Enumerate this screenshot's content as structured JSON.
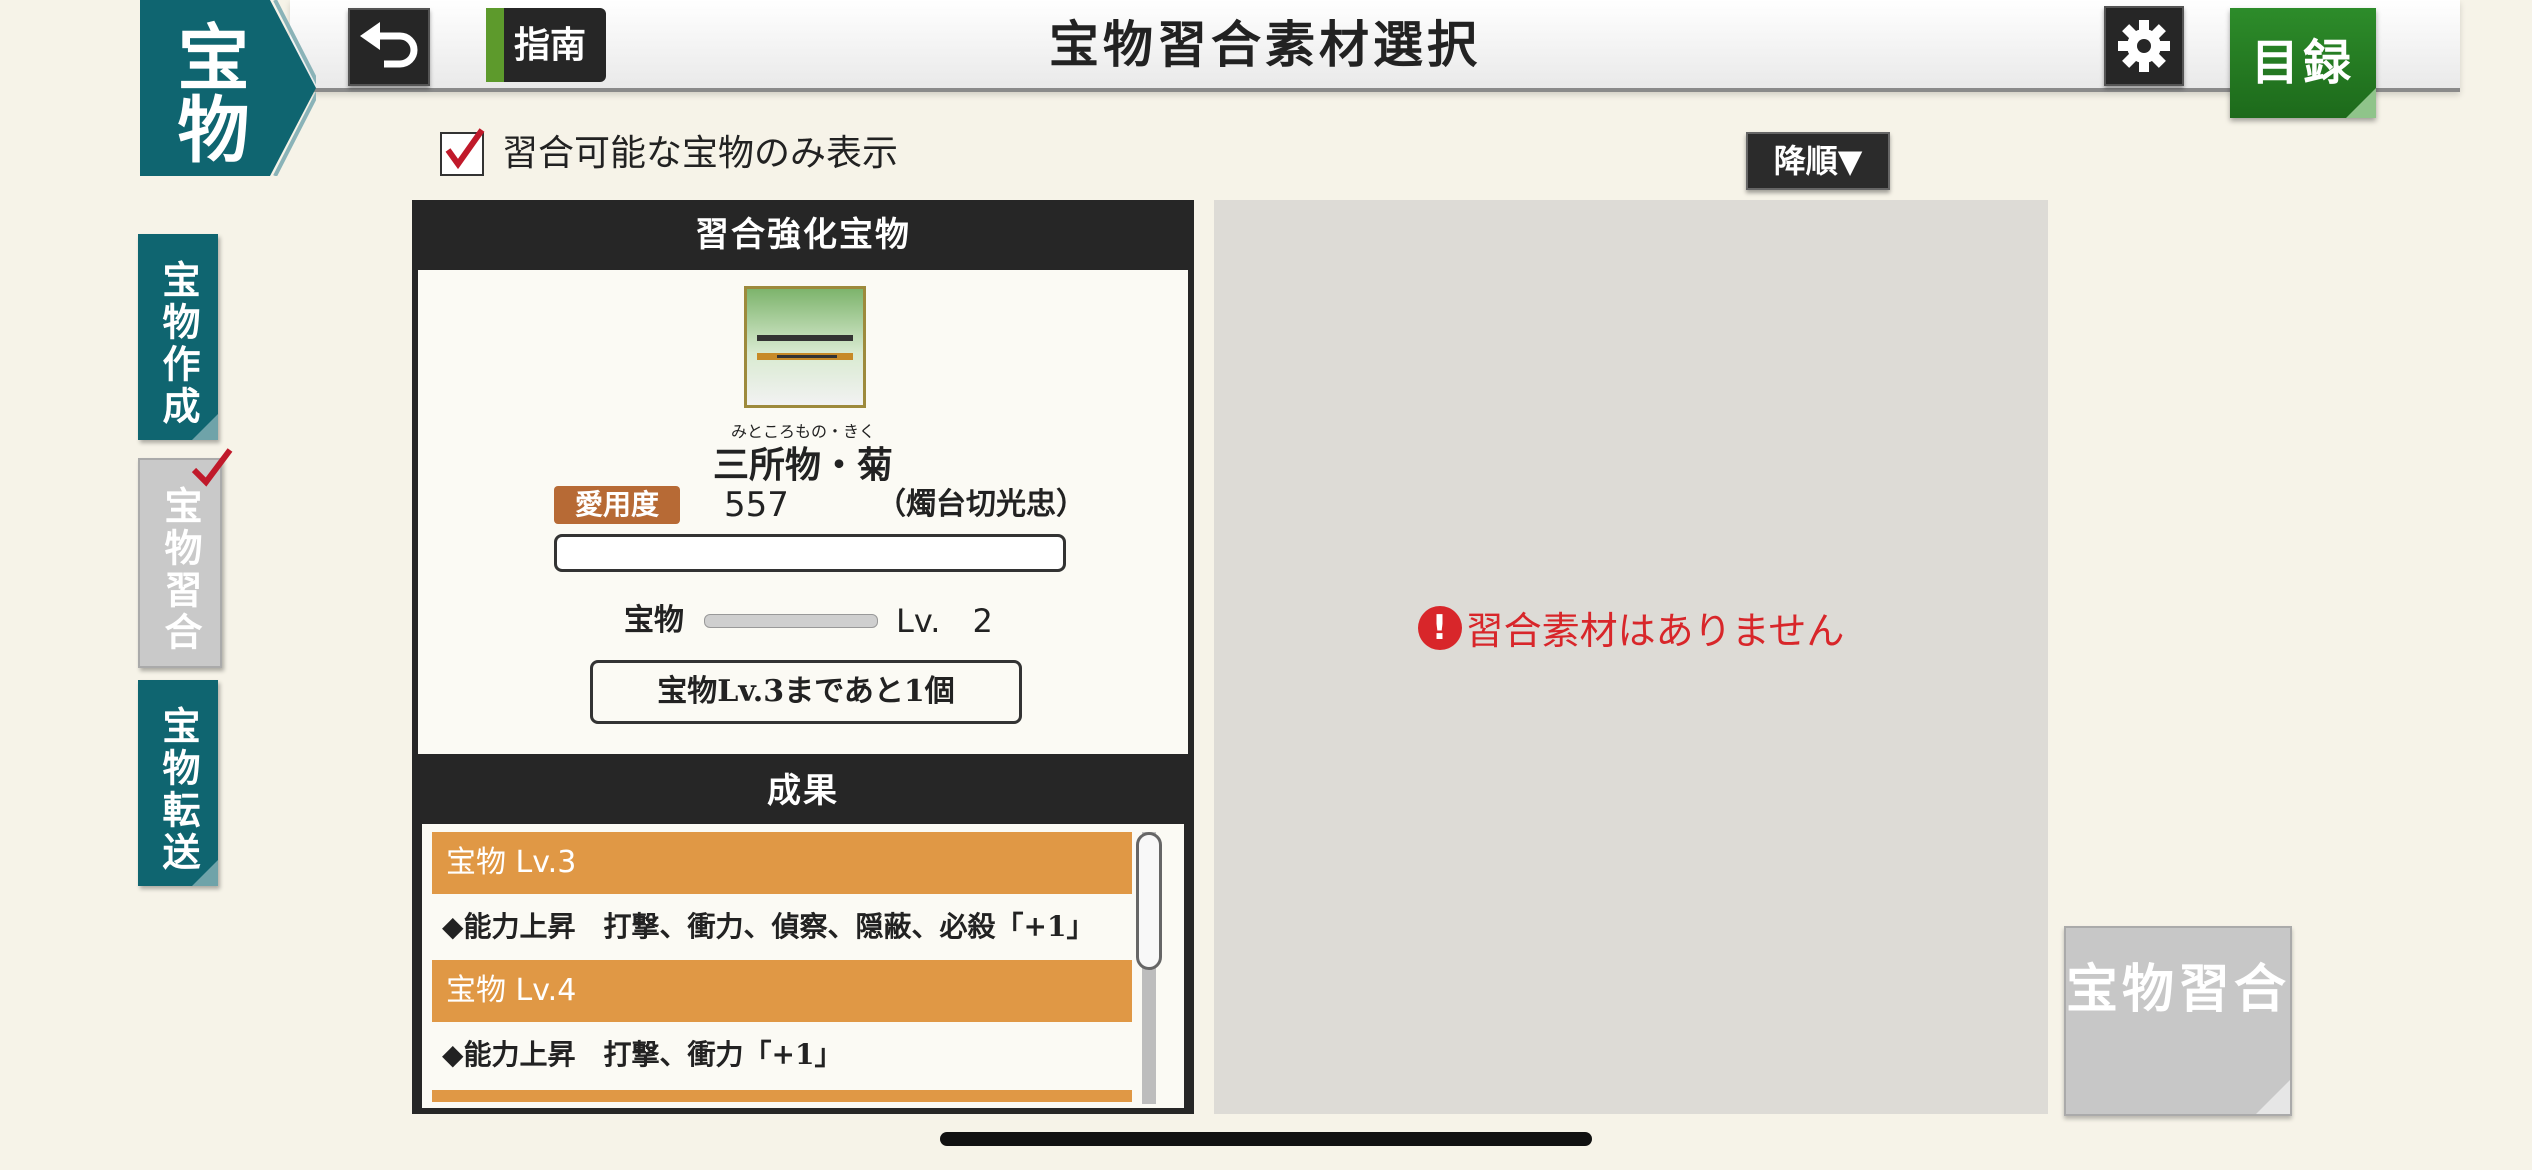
{
  "header": {
    "category_tab": "宝物",
    "title": "宝物習合素材選択",
    "guide_label": "指南",
    "catalog_label": "目録",
    "icons": {
      "back": "back-arrow-icon",
      "settings": "gear-icon"
    }
  },
  "side_tabs": [
    {
      "label": "宝物作成"
    },
    {
      "label": "宝物習合"
    },
    {
      "label": "宝物転送"
    }
  ],
  "filter": {
    "label": "習合可能な宝物のみ表示",
    "checked": true
  },
  "sort_label": "降順▼",
  "enhance_panel": {
    "header": "習合強化宝物",
    "item_ruby": "みところもの・きく",
    "item_name": "三所物・菊",
    "affinity_label": "愛用度",
    "affinity_value": "557",
    "sword_name": "（燭台切光忠）",
    "level_label": "宝物",
    "level_text": "Lv.　2",
    "next_level_text": "宝物Lv.3まであと1個"
  },
  "results": {
    "header": "成果",
    "rows": [
      {
        "head": "宝物 Lv.3",
        "desc": "◆能力上昇　打撃、衝力、偵察、隠蔽、必殺「+1」"
      },
      {
        "head": "宝物 Lv.4",
        "desc": "◆能力上昇　打撃、衝力「+1」"
      }
    ]
  },
  "material_panel": {
    "empty_message": "習合素材はありません",
    "alert_glyph": "!"
  },
  "merge_button": "宝物習合",
  "colors": {
    "teal": "#0f6570",
    "green": "#2d8c2a",
    "orange": "#e09845",
    "alert": "#d8262a"
  }
}
